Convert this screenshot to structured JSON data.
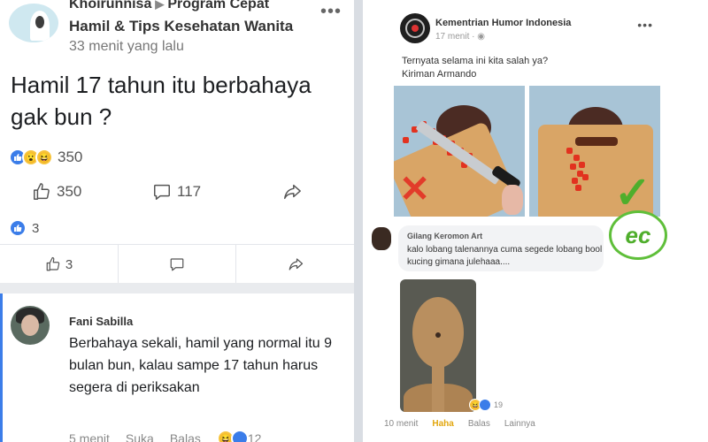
{
  "left_post": {
    "author": "Khoirunnisa",
    "group": "Program Cepat",
    "group_line2": "Hamil & Tips Kesehatan Wanita",
    "time": "33 menit yang lalu",
    "more": "•••",
    "text": "Hamil 17 tahun itu berbahaya gak bun ?",
    "reaction_count": "350",
    "like_count": "350",
    "comment_count": "117",
    "likes_bottom": "3",
    "action_like_count": "3"
  },
  "comment": {
    "author": "Fani Sabilla",
    "text": "Berbahaya sekali, hamil yang normal itu 9 bulan bun, kalau sampe 17 tahun harus segera di periksakan",
    "time": "5 menit",
    "like": "Suka",
    "reply": "Balas",
    "reaction_count": "12"
  },
  "right_post": {
    "author": "Kementrian Humor Indonesia",
    "time": "17 menit ·",
    "more": "•••",
    "text_line1": "Ternyata selama ini kita salah ya?",
    "text_line2": "Kiriman Armando",
    "badge": "ec",
    "comment": {
      "author": "Gilang Keromon Art",
      "text": "kalo lobang talenannya cuma segede lobang bool kucing gimana julehaaa....",
      "reaction_count": "19",
      "time": "10 menit",
      "reaction_label": "Haha",
      "reply": "Balas",
      "more": "Lainnya"
    }
  },
  "colors": {
    "like_blue": "#3b7de9",
    "wow_yellow": "#f7c43b",
    "badge_green": "#4fae2c",
    "x_red": "#e23b2a"
  },
  "icons": [
    "like-icon",
    "comment-icon",
    "share-icon",
    "more-icon"
  ]
}
